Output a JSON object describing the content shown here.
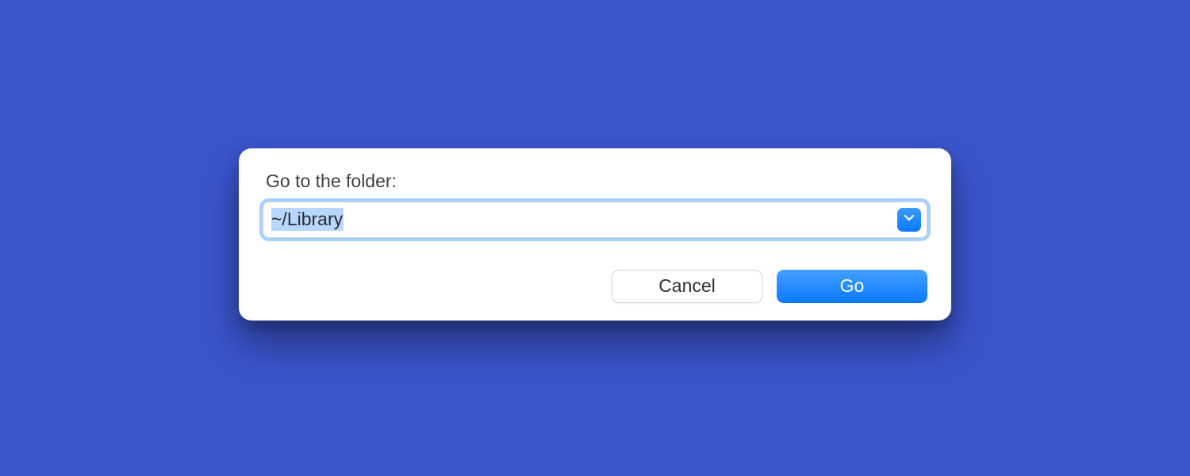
{
  "dialog": {
    "label": "Go to the folder:",
    "input_value": "~/Library",
    "buttons": {
      "cancel": "Cancel",
      "go": "Go"
    }
  },
  "colors": {
    "background": "#3a54cc",
    "accent": "#0a7aff",
    "selection": "#b7d7ff"
  }
}
